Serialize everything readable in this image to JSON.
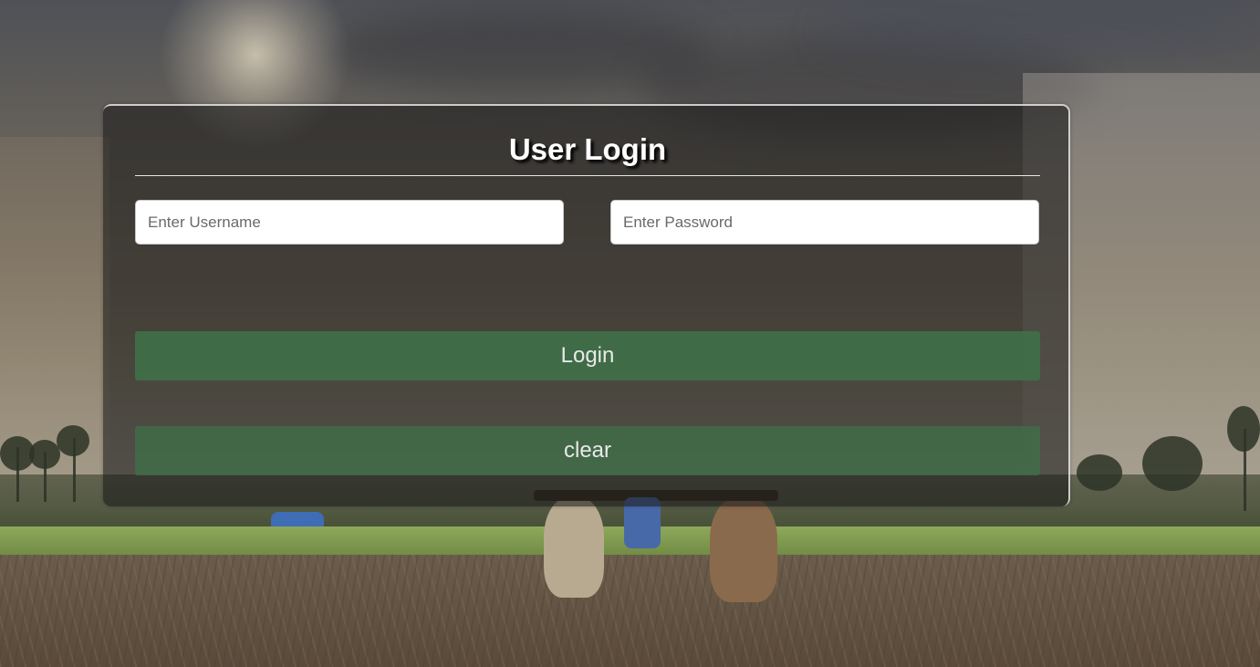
{
  "login_form": {
    "title": "User Login",
    "username_placeholder": "Enter Username",
    "password_placeholder": "Enter Password",
    "login_label": "Login",
    "clear_label": "clear"
  },
  "colors": {
    "panel_background": "#191919",
    "button_green": "#3f7048",
    "title_text": "#ffffff"
  }
}
